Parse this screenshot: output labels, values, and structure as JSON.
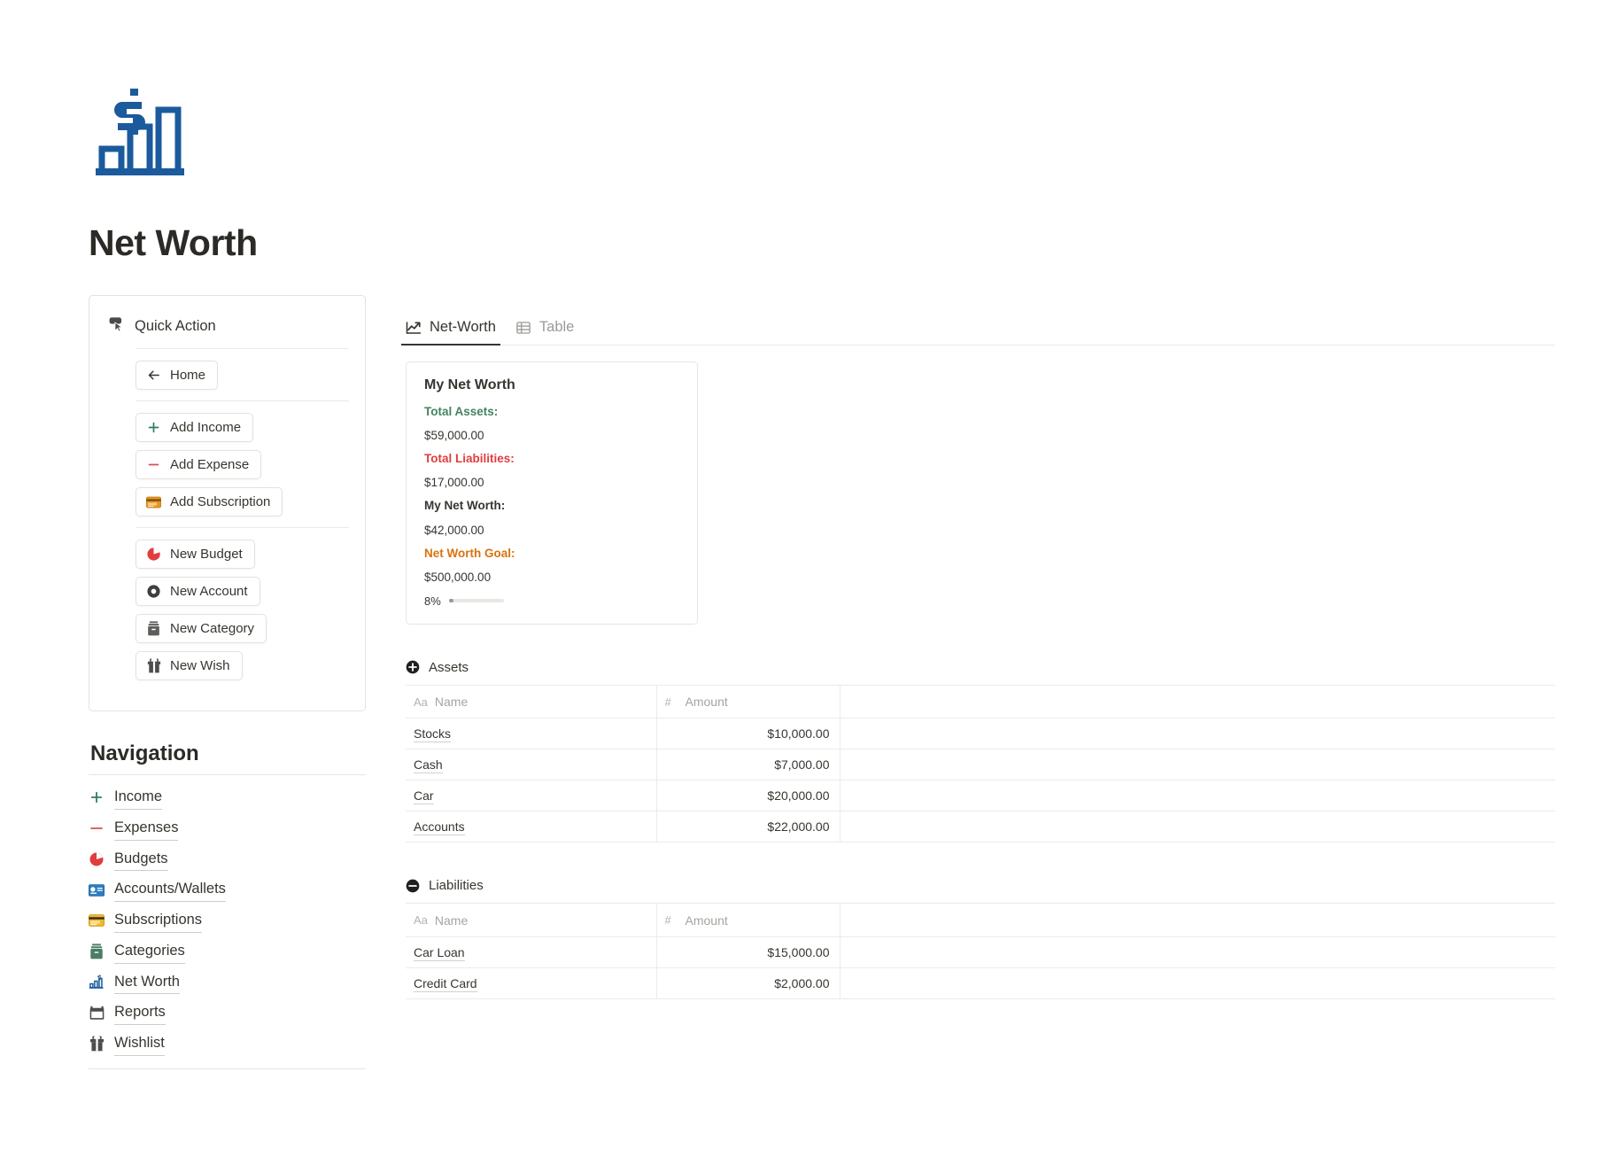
{
  "page": {
    "title": "Net Worth",
    "hero_icon": "bar-chart-dollar-icon"
  },
  "quick_action": {
    "heading": "Quick Action",
    "heading_icon": "click-cursor-icon",
    "groups": [
      {
        "items": [
          {
            "label": "Home",
            "icon": "arrow-left-icon"
          }
        ]
      },
      {
        "items": [
          {
            "label": "Add Income",
            "icon": "plus-icon"
          },
          {
            "label": "Add Expense",
            "icon": "minus-icon"
          },
          {
            "label": "Add Subscription",
            "icon": "credit-card-icon"
          }
        ]
      },
      {
        "items": [
          {
            "label": "New Budget",
            "icon": "pie-chart-icon"
          },
          {
            "label": "New Account",
            "icon": "record-circle-icon"
          },
          {
            "label": "New Category",
            "icon": "file-box-icon"
          },
          {
            "label": "New Wish",
            "icon": "gift-icon"
          }
        ]
      }
    ]
  },
  "navigation": {
    "heading": "Navigation",
    "items": [
      {
        "label": "Income",
        "icon": "plus-icon"
      },
      {
        "label": "Expenses",
        "icon": "minus-icon"
      },
      {
        "label": "Budgets",
        "icon": "pie-chart-icon"
      },
      {
        "label": "Accounts/Wallets",
        "icon": "id-card-icon"
      },
      {
        "label": "Subscriptions",
        "icon": "credit-card-icon"
      },
      {
        "label": "Categories",
        "icon": "file-box-icon"
      },
      {
        "label": "Net Worth",
        "icon": "bar-chart-dollar-icon"
      },
      {
        "label": "Reports",
        "icon": "calendar-icon"
      },
      {
        "label": "Wishlist",
        "icon": "gift-icon"
      }
    ]
  },
  "tabs": [
    {
      "label": "Net-Worth",
      "icon": "line-chart-icon",
      "active": true
    },
    {
      "label": "Table",
      "icon": "table-icon",
      "active": false
    }
  ],
  "net_worth_card": {
    "title": "My Net Worth",
    "total_assets_label": "Total Assets:",
    "total_assets_value": "$59,000.00",
    "total_liabilities_label": "Total Liabilities:",
    "total_liabilities_value": "$17,000.00",
    "net_worth_label": "My Net Worth:",
    "net_worth_value": "$42,000.00",
    "goal_label": "Net Worth Goal:",
    "goal_value": "$500,000.00",
    "progress_pct_label": "8%",
    "progress_pct": 8,
    "colors": {
      "assets": "#448361",
      "liabilities": "#e03e3e",
      "net": "#37352f",
      "goal": "#d9730d"
    }
  },
  "assets_section": {
    "heading": "Assets",
    "heading_icon": "plus-circle-icon",
    "columns": [
      {
        "label": "Name",
        "type_icon": "Aa"
      },
      {
        "label": "Amount",
        "type_icon": "#"
      },
      {
        "label": "",
        "type_icon": ""
      }
    ],
    "rows": [
      {
        "name": "Stocks",
        "amount": "$10,000.00"
      },
      {
        "name": "Cash",
        "amount": "$7,000.00"
      },
      {
        "name": "Car",
        "amount": "$20,000.00"
      },
      {
        "name": "Accounts",
        "amount": "$22,000.00"
      }
    ]
  },
  "liabilities_section": {
    "heading": "Liabilities",
    "heading_icon": "minus-circle-icon",
    "columns": [
      {
        "label": "Name",
        "type_icon": "Aa"
      },
      {
        "label": "Amount",
        "type_icon": "#"
      },
      {
        "label": "",
        "type_icon": ""
      }
    ],
    "rows": [
      {
        "name": "Car Loan",
        "amount": "$15,000.00"
      },
      {
        "name": "Credit Card",
        "amount": "$2,000.00"
      }
    ]
  }
}
